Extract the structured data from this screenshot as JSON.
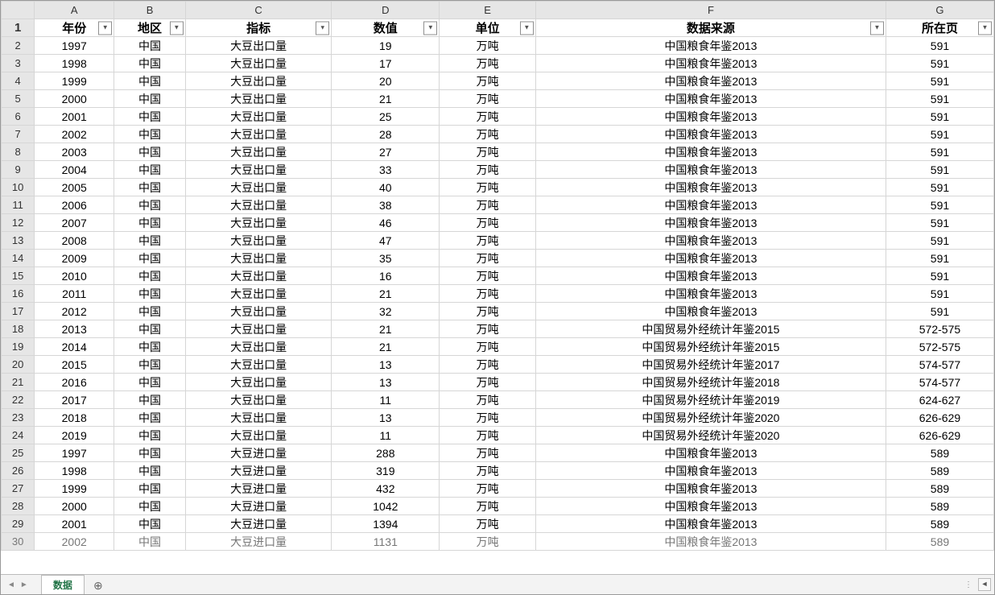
{
  "columns": [
    "A",
    "B",
    "C",
    "D",
    "E",
    "F",
    "G"
  ],
  "headers": {
    "A": "年份",
    "B": "地区",
    "C": "指标",
    "D": "数值",
    "E": "单位",
    "F": "数据来源",
    "G": "所在页"
  },
  "filter_icons": {
    "A": "▼",
    "B": "▼",
    "C": "▼",
    "D": "▼",
    "E": "▼",
    "F": "▼",
    "G": "▼"
  },
  "filtered_column": "C",
  "rows": [
    {
      "n": "2",
      "A": "1997",
      "B": "中国",
      "C": "大豆出口量",
      "D": "19",
      "E": "万吨",
      "F": "中国粮食年鉴2013",
      "G": "591"
    },
    {
      "n": "3",
      "A": "1998",
      "B": "中国",
      "C": "大豆出口量",
      "D": "17",
      "E": "万吨",
      "F": "中国粮食年鉴2013",
      "G": "591"
    },
    {
      "n": "4",
      "A": "1999",
      "B": "中国",
      "C": "大豆出口量",
      "D": "20",
      "E": "万吨",
      "F": "中国粮食年鉴2013",
      "G": "591"
    },
    {
      "n": "5",
      "A": "2000",
      "B": "中国",
      "C": "大豆出口量",
      "D": "21",
      "E": "万吨",
      "F": "中国粮食年鉴2013",
      "G": "591"
    },
    {
      "n": "6",
      "A": "2001",
      "B": "中国",
      "C": "大豆出口量",
      "D": "25",
      "E": "万吨",
      "F": "中国粮食年鉴2013",
      "G": "591"
    },
    {
      "n": "7",
      "A": "2002",
      "B": "中国",
      "C": "大豆出口量",
      "D": "28",
      "E": "万吨",
      "F": "中国粮食年鉴2013",
      "G": "591"
    },
    {
      "n": "8",
      "A": "2003",
      "B": "中国",
      "C": "大豆出口量",
      "D": "27",
      "E": "万吨",
      "F": "中国粮食年鉴2013",
      "G": "591"
    },
    {
      "n": "9",
      "A": "2004",
      "B": "中国",
      "C": "大豆出口量",
      "D": "33",
      "E": "万吨",
      "F": "中国粮食年鉴2013",
      "G": "591"
    },
    {
      "n": "10",
      "A": "2005",
      "B": "中国",
      "C": "大豆出口量",
      "D": "40",
      "E": "万吨",
      "F": "中国粮食年鉴2013",
      "G": "591"
    },
    {
      "n": "11",
      "A": "2006",
      "B": "中国",
      "C": "大豆出口量",
      "D": "38",
      "E": "万吨",
      "F": "中国粮食年鉴2013",
      "G": "591"
    },
    {
      "n": "12",
      "A": "2007",
      "B": "中国",
      "C": "大豆出口量",
      "D": "46",
      "E": "万吨",
      "F": "中国粮食年鉴2013",
      "G": "591"
    },
    {
      "n": "13",
      "A": "2008",
      "B": "中国",
      "C": "大豆出口量",
      "D": "47",
      "E": "万吨",
      "F": "中国粮食年鉴2013",
      "G": "591"
    },
    {
      "n": "14",
      "A": "2009",
      "B": "中国",
      "C": "大豆出口量",
      "D": "35",
      "E": "万吨",
      "F": "中国粮食年鉴2013",
      "G": "591"
    },
    {
      "n": "15",
      "A": "2010",
      "B": "中国",
      "C": "大豆出口量",
      "D": "16",
      "E": "万吨",
      "F": "中国粮食年鉴2013",
      "G": "591"
    },
    {
      "n": "16",
      "A": "2011",
      "B": "中国",
      "C": "大豆出口量",
      "D": "21",
      "E": "万吨",
      "F": "中国粮食年鉴2013",
      "G": "591"
    },
    {
      "n": "17",
      "A": "2012",
      "B": "中国",
      "C": "大豆出口量",
      "D": "32",
      "E": "万吨",
      "F": "中国粮食年鉴2013",
      "G": "591"
    },
    {
      "n": "18",
      "A": "2013",
      "B": "中国",
      "C": "大豆出口量",
      "D": "21",
      "E": "万吨",
      "F": "中国贸易外经统计年鉴2015",
      "G": "572-575"
    },
    {
      "n": "19",
      "A": "2014",
      "B": "中国",
      "C": "大豆出口量",
      "D": "21",
      "E": "万吨",
      "F": "中国贸易外经统计年鉴2015",
      "G": "572-575"
    },
    {
      "n": "20",
      "A": "2015",
      "B": "中国",
      "C": "大豆出口量",
      "D": "13",
      "E": "万吨",
      "F": "中国贸易外经统计年鉴2017",
      "G": "574-577"
    },
    {
      "n": "21",
      "A": "2016",
      "B": "中国",
      "C": "大豆出口量",
      "D": "13",
      "E": "万吨",
      "F": "中国贸易外经统计年鉴2018",
      "G": "574-577"
    },
    {
      "n": "22",
      "A": "2017",
      "B": "中国",
      "C": "大豆出口量",
      "D": "11",
      "E": "万吨",
      "F": "中国贸易外经统计年鉴2019",
      "G": "624-627"
    },
    {
      "n": "23",
      "A": "2018",
      "B": "中国",
      "C": "大豆出口量",
      "D": "13",
      "E": "万吨",
      "F": "中国贸易外经统计年鉴2020",
      "G": "626-629"
    },
    {
      "n": "24",
      "A": "2019",
      "B": "中国",
      "C": "大豆出口量",
      "D": "11",
      "E": "万吨",
      "F": "中国贸易外经统计年鉴2020",
      "G": "626-629"
    },
    {
      "n": "25",
      "A": "1997",
      "B": "中国",
      "C": "大豆进口量",
      "D": "288",
      "E": "万吨",
      "F": "中国粮食年鉴2013",
      "G": "589"
    },
    {
      "n": "26",
      "A": "1998",
      "B": "中国",
      "C": "大豆进口量",
      "D": "319",
      "E": "万吨",
      "F": "中国粮食年鉴2013",
      "G": "589"
    },
    {
      "n": "27",
      "A": "1999",
      "B": "中国",
      "C": "大豆进口量",
      "D": "432",
      "E": "万吨",
      "F": "中国粮食年鉴2013",
      "G": "589"
    },
    {
      "n": "28",
      "A": "2000",
      "B": "中国",
      "C": "大豆进口量",
      "D": "1042",
      "E": "万吨",
      "F": "中国粮食年鉴2013",
      "G": "589"
    },
    {
      "n": "29",
      "A": "2001",
      "B": "中国",
      "C": "大豆进口量",
      "D": "1394",
      "E": "万吨",
      "F": "中国粮食年鉴2013",
      "G": "589"
    }
  ],
  "cutoff_row": {
    "n": "30",
    "A": "2002",
    "B": "中国",
    "C": "大豆进口量",
    "D": "1131",
    "E": "万吨",
    "F": "中国粮食年鉴2013",
    "G": "589"
  },
  "sheet_tab": "数据",
  "tab_add_glyph": "⊕",
  "nav": {
    "first": "◄◄",
    "prev": "◄",
    "next": "►",
    "last": "►►"
  },
  "hscroll": {
    "dots": "⋮",
    "left": "◄",
    "right": "►"
  }
}
